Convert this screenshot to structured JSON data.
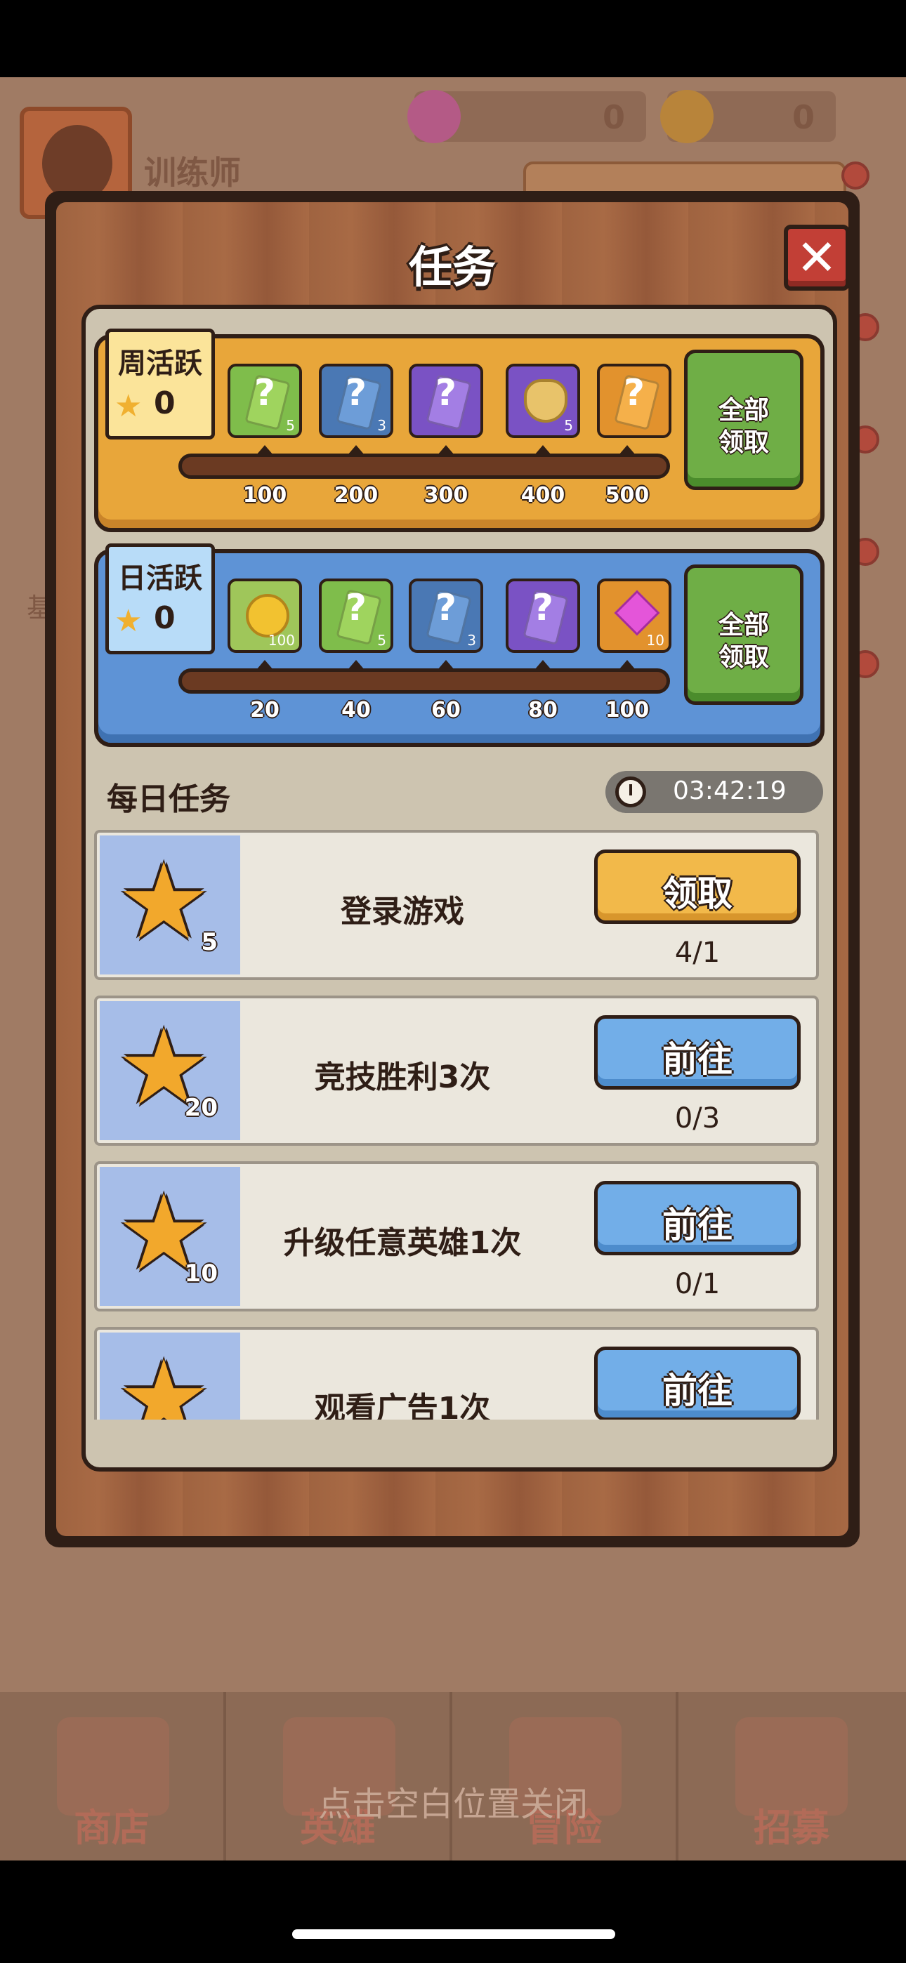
{
  "background": {
    "player_name": "训练师",
    "gems": "0",
    "coins": "0",
    "side_text": "基",
    "tabs": [
      "商店",
      "英雄",
      "冒险",
      "招募"
    ]
  },
  "modal": {
    "title": "任务",
    "close_glyph": "✕",
    "weekly": {
      "label": "周活跃",
      "points": "0",
      "rewards": [
        {
          "icon": "green-card-icon",
          "count": "5"
        },
        {
          "icon": "blue-card-icon",
          "count": "3"
        },
        {
          "icon": "purple-card-icon",
          "count": ""
        },
        {
          "icon": "purple-chest-icon",
          "count": "5"
        },
        {
          "icon": "orange-card-icon",
          "count": ""
        }
      ],
      "milestones": [
        "100",
        "200",
        "300",
        "400",
        "500"
      ],
      "claim_all_line1": "全部",
      "claim_all_line2": "领取"
    },
    "daily": {
      "label": "日活跃",
      "points": "0",
      "rewards": [
        {
          "icon": "coin-icon",
          "count": "100"
        },
        {
          "icon": "green-card-icon",
          "count": "5"
        },
        {
          "icon": "blue-cards-icon",
          "count": "3"
        },
        {
          "icon": "purple-cards-icon",
          "count": ""
        },
        {
          "icon": "gem-icon",
          "count": "10"
        }
      ],
      "milestones": [
        "20",
        "40",
        "60",
        "80",
        "100"
      ],
      "claim_all_line1": "全部",
      "claim_all_line2": "领取"
    },
    "daily_tasks": {
      "title": "每日任务",
      "timer": "03:42:19",
      "tasks": [
        {
          "points": "5",
          "name": "登录游戏",
          "button": "领取",
          "progress": "4/1"
        },
        {
          "points": "20",
          "name": "竞技胜利3次",
          "button": "前往",
          "progress": "0/3"
        },
        {
          "points": "10",
          "name": "升级任意英雄1次",
          "button": "前往",
          "progress": "0/1"
        },
        {
          "points": "",
          "name": "观看广告1次",
          "button": "前往",
          "progress": ""
        }
      ]
    }
  },
  "close_hint": "点击空白位置关闭",
  "colors": {
    "weekly_bar": "#e8a63a",
    "daily_bar": "#5e93d6",
    "claim_button": "#f2b94a",
    "go_button": "#72aee8",
    "claim_all": "#6fae46"
  }
}
